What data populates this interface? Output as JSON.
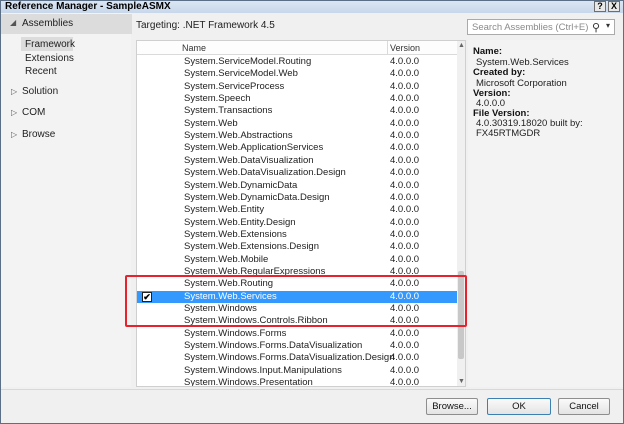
{
  "window": {
    "title": "Reference Manager - SampleASMX",
    "help_btn": "?",
    "close_btn": "X"
  },
  "nav": {
    "header": "Assemblies",
    "header_arrow": "◢",
    "sub_items": [
      "Framework",
      "Extensions",
      "Recent"
    ],
    "groups": [
      {
        "arrow": "▷",
        "label": "Solution"
      },
      {
        "arrow": "▷",
        "label": "COM"
      },
      {
        "arrow": "▷",
        "label": "Browse"
      }
    ]
  },
  "targeting": "Targeting: .NET Framework 4.5",
  "list": {
    "col_name": "Name",
    "col_version": "Version",
    "rows": [
      {
        "name": "System.ServiceModel.Routing",
        "version": "4.0.0.0"
      },
      {
        "name": "System.ServiceModel.Web",
        "version": "4.0.0.0"
      },
      {
        "name": "System.ServiceProcess",
        "version": "4.0.0.0"
      },
      {
        "name": "System.Speech",
        "version": "4.0.0.0"
      },
      {
        "name": "System.Transactions",
        "version": "4.0.0.0"
      },
      {
        "name": "System.Web",
        "version": "4.0.0.0"
      },
      {
        "name": "System.Web.Abstractions",
        "version": "4.0.0.0"
      },
      {
        "name": "System.Web.ApplicationServices",
        "version": "4.0.0.0"
      },
      {
        "name": "System.Web.DataVisualization",
        "version": "4.0.0.0"
      },
      {
        "name": "System.Web.DataVisualization.Design",
        "version": "4.0.0.0"
      },
      {
        "name": "System.Web.DynamicData",
        "version": "4.0.0.0"
      },
      {
        "name": "System.Web.DynamicData.Design",
        "version": "4.0.0.0"
      },
      {
        "name": "System.Web.Entity",
        "version": "4.0.0.0"
      },
      {
        "name": "System.Web.Entity.Design",
        "version": "4.0.0.0"
      },
      {
        "name": "System.Web.Extensions",
        "version": "4.0.0.0"
      },
      {
        "name": "System.Web.Extensions.Design",
        "version": "4.0.0.0"
      },
      {
        "name": "System.Web.Mobile",
        "version": "4.0.0.0"
      },
      {
        "name": "System.Web.RegularExpressions",
        "version": "4.0.0.0"
      },
      {
        "name": "System.Web.Routing",
        "version": "4.0.0.0"
      },
      {
        "name": "System.Web.Services",
        "version": "4.0.0.0",
        "selected": true,
        "checked": true
      },
      {
        "name": "System.Windows",
        "version": "4.0.0.0"
      },
      {
        "name": "System.Windows.Controls.Ribbon",
        "version": "4.0.0.0"
      },
      {
        "name": "System.Windows.Forms",
        "version": "4.0.0.0"
      },
      {
        "name": "System.Windows.Forms.DataVisualization",
        "version": "4.0.0.0"
      },
      {
        "name": "System.Windows.Forms.DataVisualization.Design",
        "version": "4.0.0.0"
      },
      {
        "name": "System.Windows.Input.Manipulations",
        "version": "4.0.0.0"
      },
      {
        "name": "System.Windows.Presentation",
        "version": "4.0.0.0"
      }
    ]
  },
  "search": {
    "placeholder": "Search Assemblies (Ctrl+E)",
    "icon": "search-icon",
    "dropdown": "▾"
  },
  "details": {
    "name_label": "Name:",
    "name_value": "System.Web.Services",
    "created_label": "Created by:",
    "created_value": "Microsoft Corporation",
    "version_label": "Version:",
    "version_value": "4.0.0.0",
    "file_version_label": "File Version:",
    "file_version_value_1": "4.0.30319.18020 built by:",
    "file_version_value_2": "FX45RTMGDR"
  },
  "buttons": {
    "browse": "Browse...",
    "ok": "OK",
    "cancel": "Cancel"
  },
  "colors": {
    "selection": "#3399ff",
    "highlight_box": "#e8222d"
  }
}
